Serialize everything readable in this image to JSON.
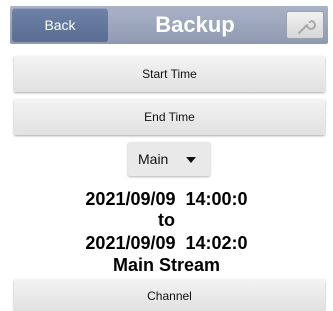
{
  "header": {
    "back_label": "Back",
    "title": "Backup",
    "tool_icon": "wrench-icon"
  },
  "buttons": {
    "start_time": "Start Time",
    "end_time": "End Time",
    "channel": "Channel"
  },
  "stream_select": {
    "value": "Main",
    "icon": "chevron-down-icon"
  },
  "summary": {
    "start": "2021/09/09  14:00:0",
    "to": "to",
    "end": "2021/09/09  14:02:0",
    "stream": "Main Stream"
  },
  "colors": {
    "titlebar": "#9aa3b8",
    "back_button": "#647599",
    "button_bg": "#e8e8e8"
  }
}
